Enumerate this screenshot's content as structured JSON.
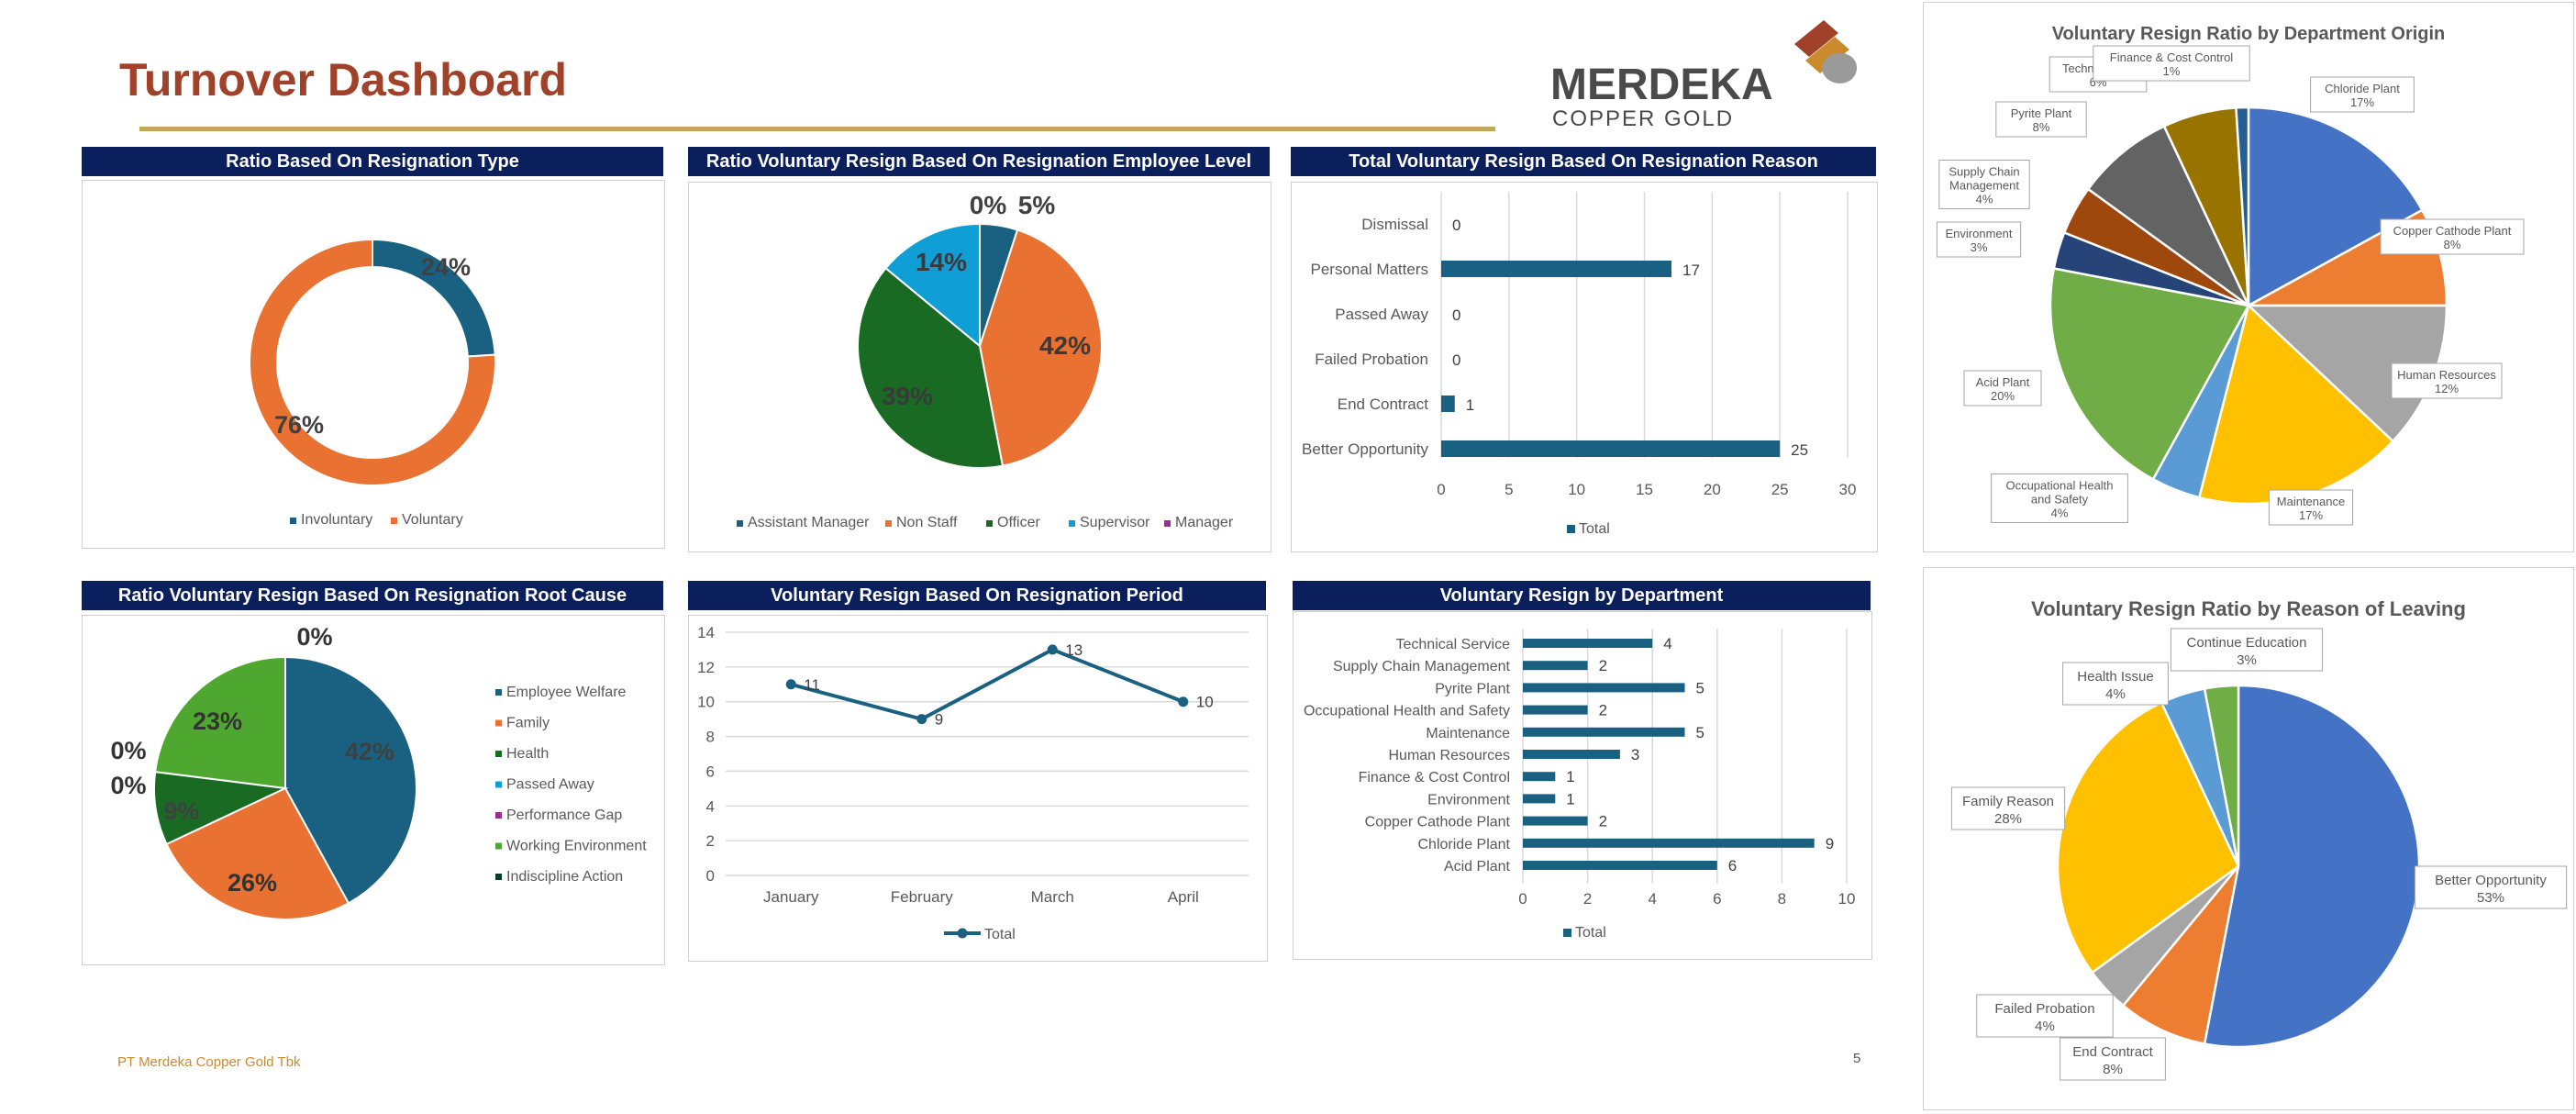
{
  "page": {
    "title": "Turnover Dashboard",
    "footer": "PT Merdeka Copper Gold Tbk",
    "page_number": "5"
  },
  "logo": {
    "name": "MERDEKA",
    "sub": "COPPER GOLD"
  },
  "colors": {
    "header_bg": "#0B1F5C",
    "title": "#A0422A",
    "rule": "#C4A65A",
    "navy_series": "#1A6080",
    "orange": "#E97132",
    "green_dark": "#196B24",
    "cyan": "#0F9ED5",
    "purple": "#A02B93",
    "green_light": "#4EA72E",
    "blue": "#4472C4",
    "orange2": "#ED7D31",
    "gray": "#A5A5A5",
    "gold": "#FFC000",
    "lightblue": "#5B9BD5",
    "green2": "#70AD47"
  },
  "chart_data": [
    {
      "id": "resignation-type",
      "type": "pie",
      "variant": "donut",
      "title": "Ratio Based On Resignation Type",
      "labels": [
        "Involuntary",
        "Voluntary"
      ],
      "values": [
        24,
        76
      ],
      "value_labels": [
        "24%",
        "76%"
      ],
      "colors": [
        "#1A6080",
        "#E97132"
      ],
      "legend": "bottom"
    },
    {
      "id": "employee-level",
      "type": "pie",
      "title": "Ratio Voluntary Resign Based On Resignation Employee Level",
      "labels": [
        "Assistant Manager",
        "Non Staff",
        "Officer",
        "Supervisor",
        "Manager"
      ],
      "values": [
        5,
        42,
        39,
        14,
        0
      ],
      "value_labels": [
        "5%",
        "42%",
        "39%",
        "14%",
        "0%"
      ],
      "colors": [
        "#1A6080",
        "#E97132",
        "#196B24",
        "#0F9ED5",
        "#A02B93"
      ],
      "legend": "bottom"
    },
    {
      "id": "resignation-reason",
      "type": "bar",
      "orientation": "horizontal",
      "title": "Total Voluntary Resign Based On Resignation Reason",
      "categories": [
        "Dismissal",
        "Personal Matters",
        "Passed Away",
        "Failed Probation",
        "End Contract",
        "Better Opportunity"
      ],
      "values": [
        0,
        17,
        0,
        0,
        1,
        25
      ],
      "xlim": [
        0,
        30
      ],
      "ticks": [
        "0",
        "5",
        "10",
        "15",
        "20",
        "25",
        "30"
      ],
      "series_name": "Total",
      "color": "#1A6080",
      "legend": "bottom",
      "grid": true
    },
    {
      "id": "root-cause",
      "type": "pie",
      "title": "Ratio Voluntary Resign Based On Resignation Root Cause",
      "labels": [
        "Employee Welfare",
        "Family",
        "Health",
        "Passed Away",
        "Performance Gap",
        "Working Environment",
        "Indiscipline Action"
      ],
      "values": [
        42,
        26,
        9,
        0,
        0,
        23,
        0
      ],
      "value_labels": [
        "42%",
        "26%",
        "9%",
        "0%",
        "0%",
        "23%",
        "0%"
      ],
      "colors": [
        "#1A6080",
        "#E97132",
        "#196B24",
        "#0F9ED5",
        "#A02B93",
        "#4EA72E",
        "#0A3D2B"
      ],
      "legend": "right"
    },
    {
      "id": "resignation-period",
      "type": "line",
      "title": "Voluntary Resign Based On Resignation Period",
      "categories": [
        "January",
        "February",
        "March",
        "April"
      ],
      "values": [
        11,
        9,
        13,
        10
      ],
      "ylim": [
        0,
        14
      ],
      "ticks": [
        "0",
        "2",
        "4",
        "6",
        "8",
        "10",
        "12",
        "14"
      ],
      "series_name": "Total",
      "color": "#1A6080",
      "legend": "bottom",
      "grid": true
    },
    {
      "id": "by-department",
      "type": "bar",
      "orientation": "horizontal",
      "title": "Voluntary Resign by Department",
      "categories": [
        "Technical Service",
        "Supply Chain Management",
        "Pyrite Plant",
        "Occupational Health and Safety",
        "Maintenance",
        "Human Resources",
        "Finance & Cost Control",
        "Environment",
        "Copper Cathode Plant",
        "Chloride Plant",
        "Acid Plant"
      ],
      "values": [
        4,
        2,
        5,
        2,
        5,
        3,
        1,
        1,
        2,
        9,
        6
      ],
      "xlim": [
        0,
        10
      ],
      "ticks": [
        "0",
        "2",
        "4",
        "6",
        "8",
        "10"
      ],
      "series_name": "Total",
      "color": "#1A6080",
      "legend": "bottom",
      "grid": true
    },
    {
      "id": "department-origin",
      "type": "pie",
      "title": "Voluntary Resign Ratio by Department Origin",
      "labels": [
        "Chloride Plant",
        "Copper Cathode Plant",
        "Human Resources",
        "Maintenance",
        "Occupational Health and Safety",
        "Acid Plant",
        "Environment",
        "Supply Chain Management",
        "Pyrite Plant",
        "Technical Service",
        "Finance & Cost Control"
      ],
      "display_labels": [
        "Chloride Plant",
        "Copper Cathode Plant",
        "Human Resources",
        "Maintenance",
        "Occupational Health\nand Safety",
        "Acid Plant",
        "Environment",
        "Supply Chain\nManagement",
        "Pyrite Plant",
        "Technical Ser",
        "Finance & Cost Control"
      ],
      "values": [
        17,
        8,
        12,
        17,
        4,
        20,
        3,
        4,
        8,
        6,
        1
      ],
      "value_labels": [
        "17%",
        "8%",
        "12%",
        "17%",
        "4%",
        "20%",
        "3%",
        "4%",
        "8%",
        "6%",
        "1%"
      ],
      "colors": [
        "#4472C4",
        "#ED7D31",
        "#A5A5A5",
        "#FFC000",
        "#5B9BD5",
        "#70AD47",
        "#264478",
        "#9E480E",
        "#636363",
        "#997300",
        "#255E91"
      ]
    },
    {
      "id": "reason-of-leaving",
      "type": "pie",
      "title": "Voluntary Resign Ratio by Reason of Leaving",
      "labels": [
        "Better Opportunity",
        "End Contract",
        "Failed Probation",
        "Family Reason",
        "Health Issue",
        "Continue Education"
      ],
      "values": [
        53,
        8,
        4,
        28,
        4,
        3
      ],
      "value_labels": [
        "53%",
        "8%",
        "4%",
        "28%",
        "4%",
        "3%"
      ],
      "colors": [
        "#4472C4",
        "#ED7D31",
        "#A5A5A5",
        "#FFC000",
        "#5B9BD5",
        "#70AD47"
      ]
    }
  ]
}
